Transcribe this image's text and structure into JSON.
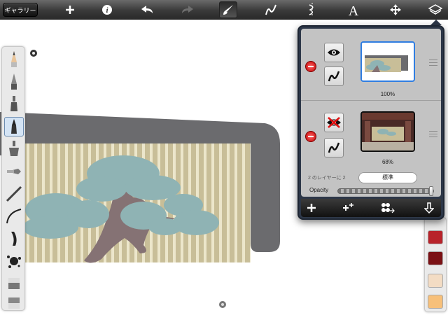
{
  "toolbar": {
    "gallery_label": "ギャラリー",
    "tools": [
      {
        "name": "add-icon"
      },
      {
        "name": "info-icon"
      },
      {
        "name": "undo-icon"
      },
      {
        "name": "redo-icon"
      },
      {
        "name": "brush-icon",
        "selected": true
      },
      {
        "name": "stroke-icon"
      },
      {
        "name": "symmetry-icon"
      },
      {
        "name": "text-icon"
      },
      {
        "name": "move-icon"
      },
      {
        "name": "layers-icon"
      }
    ]
  },
  "brushes": [
    {
      "name": "pencil-icon"
    },
    {
      "name": "pen-icon"
    },
    {
      "name": "marker-icon"
    },
    {
      "name": "ink-pen-icon",
      "selected": true
    },
    {
      "name": "airbrush-icon"
    },
    {
      "name": "flat-brush-icon"
    },
    {
      "name": "paint-brush-icon"
    },
    {
      "name": "curve-brush-icon"
    },
    {
      "name": "wet-brush-icon"
    },
    {
      "name": "splatter-icon"
    },
    {
      "name": "eraser-icon"
    },
    {
      "name": "smudge-icon"
    }
  ],
  "colors": {
    "swatches": [
      "#b8232a",
      "#7b1115",
      "#f3dcc4",
      "#f7c07a"
    ],
    "stroke_gray": "#6b6b6e",
    "stripe_bg": "#c8be98",
    "tree_leaf": "#8fb3b4",
    "tree_trunk": "#857274"
  },
  "layers": {
    "items": [
      {
        "name": "layer-1",
        "visibility_icon": "eye-icon",
        "opacity_label": "100%",
        "selected": true
      },
      {
        "name": "layer-2",
        "visibility_icon": "eye-hidden-icon",
        "opacity_label": "68%",
        "selected": false
      }
    ],
    "count_label": "2 のレイヤーに 2",
    "blend_mode": "標準",
    "opacity_label": "Opacity",
    "opacity_value": 1.0,
    "footer": [
      {
        "name": "add-layer-icon"
      },
      {
        "name": "add-layer-from-image-icon"
      },
      {
        "name": "layer-actions-icon"
      },
      {
        "name": "merge-down-icon"
      }
    ]
  }
}
